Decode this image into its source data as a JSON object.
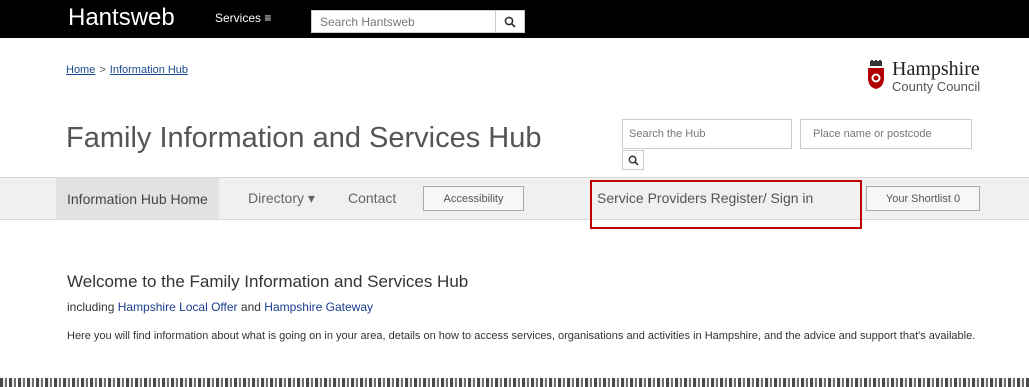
{
  "topbar": {
    "brand": "Hantsweb",
    "services_label": "Services ≡",
    "search_placeholder": "Search Hantsweb"
  },
  "breadcrumb": {
    "home": "Home",
    "separator": ">",
    "current": "Information Hub"
  },
  "logo": {
    "name": "Hampshire",
    "subtitle": "County Council"
  },
  "page_title": "Family Information and Services Hub",
  "hub_search": {
    "search_placeholder": "Search the Hub",
    "postcode_placeholder": "Place name or postcode"
  },
  "nav": {
    "home": "Information Hub Home",
    "directory": "Directory ▾",
    "contact": "Contact",
    "accessibility": "Accessibility",
    "register": "Service Providers Register/ Sign in",
    "shortlist": "Your Shortlist 0"
  },
  "main": {
    "welcome_title": "Welcome to the Family Information and Services Hub",
    "including_prefix": "including",
    "local_offer": "Hampshire Local Offer",
    "and_word": "and",
    "gateway": "Hampshire Gateway",
    "intro": "Here you will find information about what is going on in your area, details on how to access services, organisations and activities in Hampshire, and the advice and support that's available."
  },
  "colors": {
    "topbar": "#000000",
    "highlight": "#c00000",
    "link": "#1a4b8f"
  }
}
